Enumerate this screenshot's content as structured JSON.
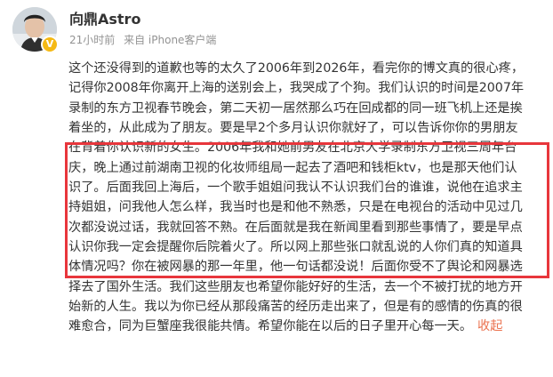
{
  "post": {
    "username": "向鼎Astro",
    "time": "21小时前",
    "source": "来自 iPhone客户端",
    "lines": [
      "这个还没得到的道歉也等的太久了2006年到2026年，看完你的博文真的很心疼，",
      "记得你2008年你离开上海的送别会上，我哭成了个狗。我们认识的时间是2007年",
      "录制的东方卫视春节晚会，第二天初一居然那么巧在回成都的同一班飞机上还是挨",
      "着坐的，从此成为了朋友。要是早2个多月认识你就好了，可以告诉你你的男朋友",
      "在背着你认识新的女生。2006年我和她前男友在北京大学录制东方卫视三周年台",
      "庆，晚上通过前湖南卫视的化妆师组局一起去了酒吧和钱柜ktv，也是那天他们认",
      "识了。后面我回上海后，一个歌手姐姐问我认不认识我们台的谁谁，说他在追求主",
      "持姐姐，问我他人怎么样，我当时也是和他不熟悉，只是在电视台的活动中见过几",
      "次都没说过话，我就回答不熟。在后面就是我在新闻里看到那些事情了，要是早点",
      "认识你我一定会提醒你后院着火了。所以网上那些张口就乱说的人你们真的知道具",
      "体情况吗？你在被网暴的那一年里，他一句话都没说！后面你受不了舆论和网暴选",
      "择去了国外生活。我们这些朋友也希望你能好好的生活，去一个不被打扰的地方开",
      "始新的人生。我以为你已经从那段痛苦的经历走出来了，但是有的感情的伤真的很",
      "难愈合，同为巨蟹座我很能共情。希望你能在以后的日子里开心每一天。"
    ],
    "collapse_label": "收起"
  },
  "icons": {
    "avatar": "avatar-photo",
    "verified": "verified-v-badge"
  },
  "colors": {
    "text": "#333333",
    "meta": "#939393",
    "link": "#eb7350",
    "highlight_border": "#e8363c",
    "verified_badge": "#f5b915"
  }
}
